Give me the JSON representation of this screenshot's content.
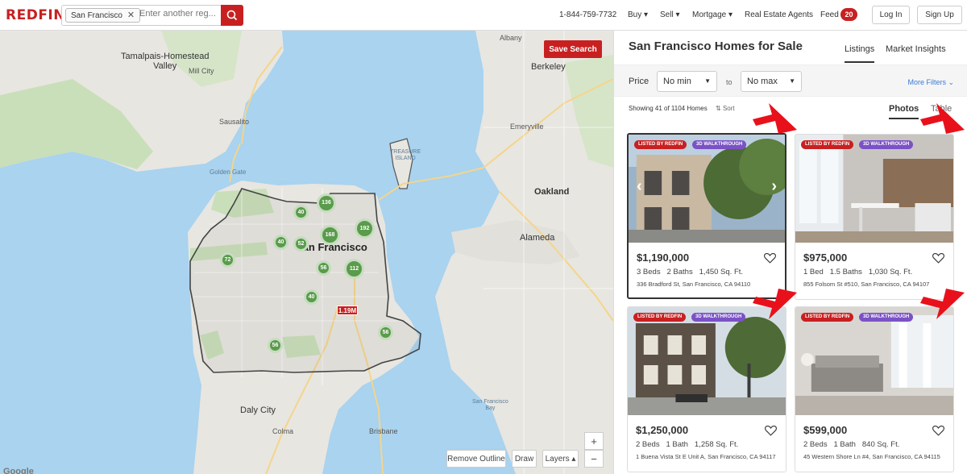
{
  "header": {
    "logo": "REDFIN",
    "search_chip": "San Francisco",
    "search_placeholder": "Enter another reg...",
    "phone": "1-844-759-7732",
    "nav": [
      "Buy ▾",
      "Sell ▾",
      "Mortgage ▾",
      "Real Estate Agents",
      "Feed"
    ],
    "feed_count": "20",
    "login": "Log In",
    "signup": "Sign Up"
  },
  "map": {
    "save_search": "Save Search",
    "labels": {
      "albany": "Albany",
      "tamalpais": "Tamalpais-Homestead\nValley",
      "berkeley": "Berkeley",
      "millcity": "Mill City",
      "sausalito": "Sausalito",
      "emeryville": "Emeryville",
      "oakland": "Oakland",
      "alameda": "Alameda",
      "sf": "San Francisco",
      "dalycity": "Daly City",
      "colma": "Colma",
      "brisbane": "Brisbane",
      "sfbay": "San Francisco\nBay",
      "goldengate": "Golden Gate",
      "treasure": "TREASURE\nISLAND"
    },
    "clusters": [
      {
        "label": "136"
      },
      {
        "label": "40"
      },
      {
        "label": "168"
      },
      {
        "label": "192"
      },
      {
        "label": "40"
      },
      {
        "label": "52"
      },
      {
        "label": "72"
      },
      {
        "label": "56"
      },
      {
        "label": "112"
      },
      {
        "label": "40"
      },
      {
        "label": "56"
      },
      {
        "label": "56"
      }
    ],
    "pin_label": "1.19M",
    "remove_outline": "Remove Outline",
    "draw": "Draw",
    "layers": "Layers ▴",
    "zoom_in": "+",
    "zoom_out": "−",
    "google": "Google"
  },
  "panel": {
    "title": "San Francisco Homes for Sale",
    "tabs": [
      "Listings",
      "Market Insights"
    ],
    "price_label": "Price",
    "min": "No min",
    "to": "to",
    "max": "No max",
    "more_filters": "More Filters ⌄",
    "showing": "Showing 41 of 1104 Homes",
    "sort": "Sort",
    "view_tabs": [
      "Photos",
      "Table"
    ],
    "listings": [
      {
        "badge1": "LISTED BY REDFIN",
        "badge2": "3D WALKTHROUGH",
        "price": "$1,190,000",
        "beds": "3 Beds",
        "baths": "2 Baths",
        "sqft": "1,450 Sq. Ft.",
        "address": "336 Bradford St, San Francisco, CA 94110"
      },
      {
        "badge1": "LISTED BY REDFIN",
        "badge2": "3D WALKTHROUGH",
        "price": "$975,000",
        "beds": "1 Bed",
        "baths": "1.5 Baths",
        "sqft": "1,030 Sq. Ft.",
        "address": "855 Folsom St #510, San Francisco, CA 94107"
      },
      {
        "badge1": "LISTED BY REDFIN",
        "badge2": "3D WALKTHROUGH",
        "price": "$1,250,000",
        "beds": "2 Beds",
        "baths": "1 Bath",
        "sqft": "1,258 Sq. Ft.",
        "address": "1 Buena Vista St E Unit A, San Francisco, CA 94117"
      },
      {
        "badge1": "LISTED BY REDFIN",
        "badge2": "3D WALKTHROUGH",
        "price": "$599,000",
        "beds": "2 Beds",
        "baths": "1 Bath",
        "sqft": "840 Sq. Ft.",
        "address": "45 Western Shore Ln #4, San Francisco, CA 94115"
      }
    ]
  },
  "colors": {
    "brand": "#c82021",
    "cluster": "#5a9b4c",
    "walkthrough": "#7b52c6",
    "water": "#a9d3ef",
    "land": "#e8e6e1"
  },
  "icons": [
    "search-icon",
    "close-icon",
    "heart-icon",
    "chevron-left-icon",
    "chevron-right-icon",
    "sort-icon",
    "red-arrow-annotation"
  ]
}
